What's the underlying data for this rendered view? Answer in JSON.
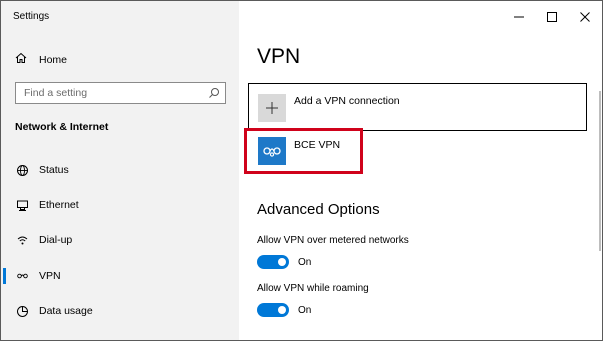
{
  "window": {
    "title": "Settings",
    "controls": {
      "minimize_icon": "minimize-icon",
      "maximize_icon": "maximize-icon",
      "close_icon": "close-icon"
    }
  },
  "sidebar": {
    "home_label": "Home",
    "search_placeholder": "Find a setting",
    "section_heading": "Network & Internet",
    "items": [
      {
        "label": "Status",
        "icon": "globe-icon",
        "active": false
      },
      {
        "label": "Ethernet",
        "icon": "ethernet-icon",
        "active": false
      },
      {
        "label": "Dial-up",
        "icon": "dialup-icon",
        "active": false
      },
      {
        "label": "VPN",
        "icon": "vpn-icon",
        "active": true
      },
      {
        "label": "Data usage",
        "icon": "data-usage-icon",
        "active": false
      }
    ]
  },
  "main": {
    "title": "VPN",
    "add_vpn_label": "Add a VPN connection",
    "vpn_connections": [
      {
        "name": "BCE VPN"
      }
    ],
    "advanced_heading": "Advanced Options",
    "options": [
      {
        "label": "Allow VPN over metered networks",
        "state": "On"
      },
      {
        "label": "Allow VPN while roaming",
        "state": "On"
      }
    ]
  },
  "colors": {
    "accent": "#0078d7",
    "vpn_tile": "#1e79c8",
    "highlight_border": "#d0021b",
    "sidebar_bg": "#f2f2f2"
  }
}
